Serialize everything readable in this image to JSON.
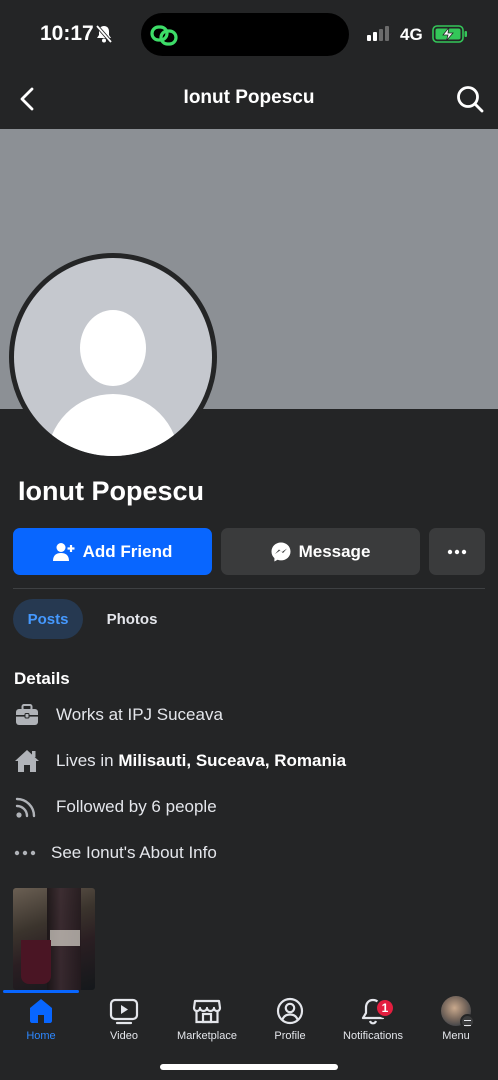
{
  "status_bar": {
    "time": "10:17",
    "network": "4G",
    "battery_state": "charging"
  },
  "nav": {
    "title": "Ionut Popescu"
  },
  "profile": {
    "name": "Ionut Popescu",
    "add_friend_label": "Add Friend",
    "message_label": "Message"
  },
  "tabs": [
    {
      "label": "Posts",
      "active": true
    },
    {
      "label": "Photos",
      "active": false
    }
  ],
  "details": {
    "title": "Details",
    "work": "Works at IPJ Suceava",
    "lives_prefix": "Lives in",
    "lives_place": "Milisauti, Suceava, Romania",
    "followed": "Followed by 6 people",
    "about": "See Ionut's About Info"
  },
  "tabbar": {
    "items": [
      {
        "label": "Home",
        "icon": "home-icon"
      },
      {
        "label": "Video",
        "icon": "video-icon"
      },
      {
        "label": "Marketplace",
        "icon": "marketplace-icon"
      },
      {
        "label": "Profile",
        "icon": "profile-icon"
      },
      {
        "label": "Notifications",
        "icon": "bell-icon",
        "badge": "1"
      },
      {
        "label": "Menu",
        "icon": "menu-avatar"
      }
    ]
  },
  "colors": {
    "background": "#242526",
    "accent": "#0866ff",
    "cover": "#8c9095",
    "badge": "#e41e3f"
  }
}
